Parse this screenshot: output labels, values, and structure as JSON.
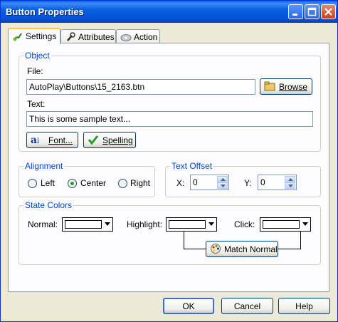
{
  "window": {
    "title": "Button Properties"
  },
  "tabs": [
    {
      "label": "Settings",
      "icon": "brush-icon"
    },
    {
      "label": "Attributes",
      "icon": "wrench-icon"
    },
    {
      "label": "Action",
      "icon": "disc-icon"
    }
  ],
  "object": {
    "title": "Object",
    "file_label": "File:",
    "file_value": "AutoPlay\\Buttons\\15_2163.btn",
    "browse_label": "Browse",
    "text_label": "Text:",
    "text_value": "This is some sample text...",
    "font_label": "Font...",
    "spelling_label": "Spelling"
  },
  "alignment": {
    "title": "Alignment",
    "options": [
      "Left",
      "Center",
      "Right"
    ],
    "selected": "Center"
  },
  "text_offset": {
    "title": "Text Offset",
    "x_label": "X:",
    "x_value": "0",
    "y_label": "Y:",
    "y_value": "0"
  },
  "state_colors": {
    "title": "State Colors",
    "normal_label": "Normal:",
    "highlight_label": "Highlight:",
    "click_label": "Click:",
    "normal_color": "#ffffff",
    "highlight_color": "#ffffff",
    "click_color": "#ffffff",
    "match_label": "Match Normal"
  },
  "buttons": {
    "ok": "OK",
    "cancel": "Cancel",
    "help": "Help"
  }
}
